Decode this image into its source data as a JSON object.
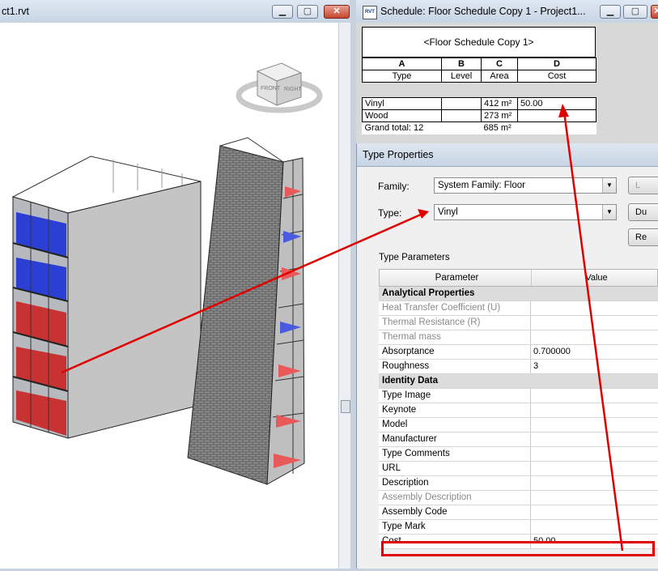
{
  "viewport": {
    "title": "ct1.rvt",
    "buttons": [
      "minimize",
      "maximize",
      "close"
    ]
  },
  "schedule_window": {
    "title": "Schedule: Floor Schedule Copy 1 - Project1...",
    "app_badge": "RVT",
    "heading": "<Floor Schedule Copy 1>",
    "column_letters": [
      "A",
      "B",
      "C",
      "D"
    ],
    "column_names": [
      "Type",
      "Level",
      "Area",
      "Cost"
    ],
    "rows": [
      {
        "type": "Vinyl",
        "level": "",
        "area": "412 m²",
        "cost": "50.00"
      },
      {
        "type": "Wood",
        "level": "",
        "area": "273 m²",
        "cost": ""
      },
      {
        "type": "Grand total: 12",
        "level": "",
        "area": "685 m²",
        "cost": ""
      }
    ]
  },
  "type_properties": {
    "title": "Type Properties",
    "family_label": "Family:",
    "family_value": "System Family: Floor",
    "type_label": "Type:",
    "type_value": "Vinyl",
    "buttons": [
      "L",
      "Du",
      "Re"
    ],
    "section_label": "Type Parameters",
    "grid_headers": [
      "Parameter",
      "Value"
    ],
    "rows": [
      {
        "kind": "group",
        "name": "Analytical Properties",
        "value": ""
      },
      {
        "kind": "disabled",
        "name": "Heat Transfer Coefficient (U)",
        "value": ""
      },
      {
        "kind": "disabled",
        "name": "Thermal Resistance (R)",
        "value": ""
      },
      {
        "kind": "disabled",
        "name": "Thermal mass",
        "value": ""
      },
      {
        "kind": "param",
        "name": "Absorptance",
        "value": "0.700000"
      },
      {
        "kind": "param",
        "name": "Roughness",
        "value": "3"
      },
      {
        "kind": "group",
        "name": "Identity Data",
        "value": ""
      },
      {
        "kind": "param",
        "name": "Type Image",
        "value": ""
      },
      {
        "kind": "param",
        "name": "Keynote",
        "value": ""
      },
      {
        "kind": "param",
        "name": "Model",
        "value": ""
      },
      {
        "kind": "param",
        "name": "Manufacturer",
        "value": ""
      },
      {
        "kind": "param",
        "name": "Type Comments",
        "value": ""
      },
      {
        "kind": "param",
        "name": "URL",
        "value": ""
      },
      {
        "kind": "param",
        "name": "Description",
        "value": ""
      },
      {
        "kind": "disabled",
        "name": "Assembly Description",
        "value": ""
      },
      {
        "kind": "param",
        "name": "Assembly Code",
        "value": ""
      },
      {
        "kind": "param",
        "name": "Type Mark",
        "value": ""
      },
      {
        "kind": "param",
        "name": "Cost",
        "value": "50.00"
      }
    ]
  },
  "view_cube": {
    "front_label": "FRONT",
    "right_label": "RIGHT"
  },
  "colors": {
    "annotation": "#e00000",
    "titlebar": "#c6d4e4",
    "close_button": "#c7442f"
  }
}
